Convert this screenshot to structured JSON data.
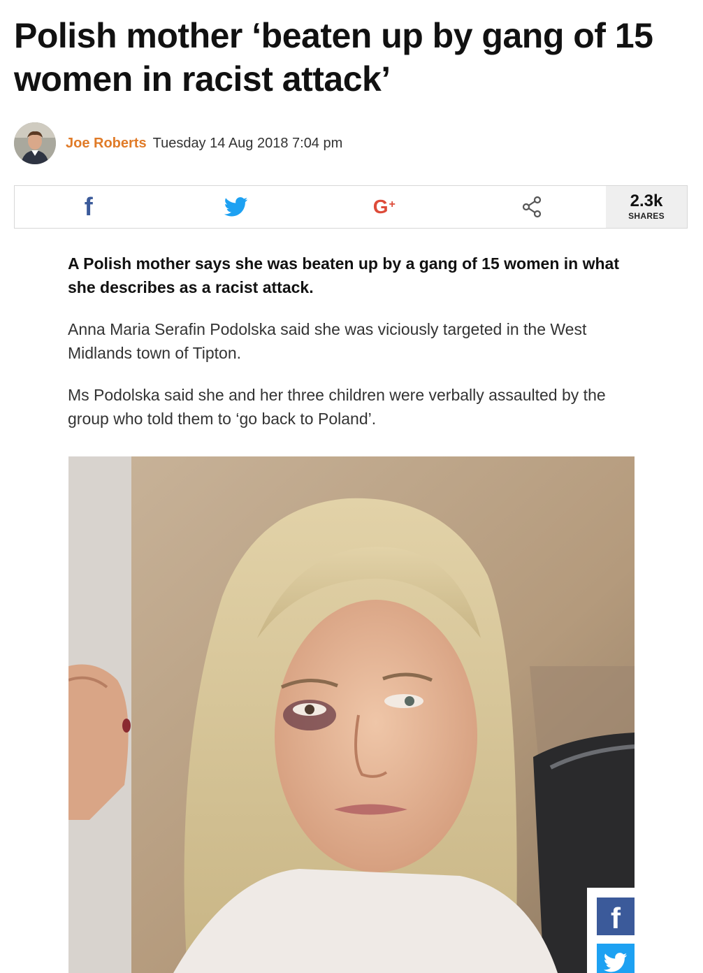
{
  "article": {
    "headline": "Polish mother ‘beaten up by gang of 15 women in racist attack’",
    "author": "Joe Roberts",
    "date": "Tuesday 14 Aug 2018 7:04 pm",
    "lede": "A Polish mother says she was beaten up by a gang of 15 women in what she describes as a racist attack.",
    "paragraphs": [
      "Anna Maria Serafin Podolska said she was viciously targeted in the West Midlands town of Tipton.",
      "Ms Podolska said she and her three children were verbally assaulted by the group who told them to ‘go back to Poland’."
    ]
  },
  "share": {
    "facebook_glyph": "f",
    "googleplus_glyph": "G",
    "googleplus_plus": "+",
    "count": "2.3k",
    "count_label": "SHARES",
    "icons": [
      "facebook-icon",
      "twitter-icon",
      "google-plus-icon",
      "share-icon"
    ]
  },
  "floating_share": {
    "facebook_glyph": "f",
    "icons": [
      "facebook-icon",
      "twitter-icon"
    ]
  },
  "colors": {
    "author": "#e07b28",
    "facebook": "#3b5a9a",
    "twitter": "#1da1f2",
    "googleplus": "#dd4b39",
    "share_count_bg": "#efefef"
  }
}
